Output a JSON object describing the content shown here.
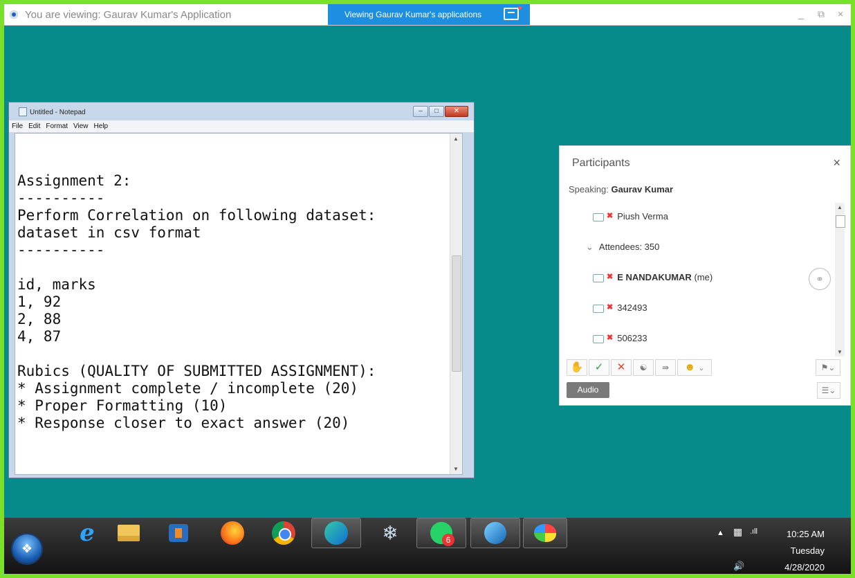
{
  "topbar": {
    "viewing_text": "You are viewing: Gaurav Kumar's Application",
    "tab_text": "Viewing Gaurav Kumar's applications",
    "minimize": "_",
    "restore": "⧉",
    "close": "×"
  },
  "notepad": {
    "title": "Untitled - Notepad",
    "menu": [
      "File",
      "Edit",
      "Format",
      "View",
      "Help"
    ],
    "content": "Assignment 2:\n----------\nPerform Correlation on following dataset:\ndataset in csv format\n----------\n\nid, marks\n1, 92\n2, 88\n4, 87\n\nRubics (QUALITY OF SUBMITTED ASSIGNMENT):\n* Assignment complete / incomplete (20)\n* Proper Formatting (10)\n* Response closer to exact answer (20)"
  },
  "participants": {
    "title": "Participants",
    "close": "×",
    "speaking_label": "Speaking:",
    "speaking_name": "Gaurav Kumar",
    "rows": [
      {
        "name": "Piush Verma",
        "suffix": ""
      },
      {
        "name": "Attendees: 350",
        "suffix": ""
      },
      {
        "name": "E NANDAKUMAR",
        "suffix": "(me)"
      },
      {
        "name": "342493",
        "suffix": ""
      },
      {
        "name": "506233",
        "suffix": ""
      }
    ],
    "audio_label": "Audio"
  },
  "taskbar": {
    "whatsapp_badge": "6",
    "time": "10:25 AM",
    "day": "Tuesday",
    "date": "4/28/2020"
  }
}
